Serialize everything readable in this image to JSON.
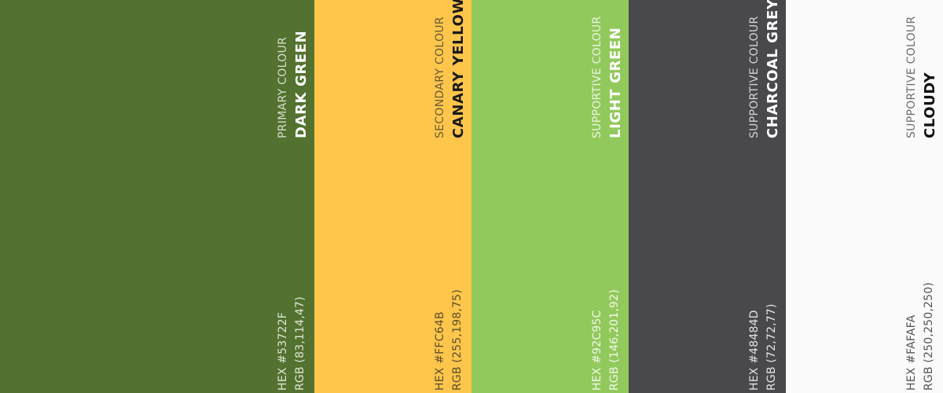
{
  "swatches": [
    {
      "role": "PRIMARY COLOUR",
      "name": "DARK GREEN",
      "hex": "HEX #53722F",
      "rgb": "RGB (83,114,47)",
      "background": "#53722F",
      "role_color": "#d6dccd",
      "name_color": "#ffffff",
      "code_color": "#dfe5d7"
    },
    {
      "role": "SECONDARY COLOUR",
      "name": "CANARY YELLOW",
      "hex": "HEX #FFC64B",
      "rgb": "RGB (255,198,75)",
      "background": "#FFC64B",
      "role_color": "#6b5a35",
      "name_color": "#1a1a1a",
      "code_color": "#5c4d2c"
    },
    {
      "role": "SUPPORTIVE COLOUR",
      "name": "LIGHT GREEN",
      "hex": "HEX #92C95C",
      "rgb": "RGB (146,201,92)",
      "background": "#92C95C",
      "role_color": "#eaf4df",
      "name_color": "#ffffff",
      "code_color": "#f2f8ea"
    },
    {
      "role": "SUPPORTIVE COLOUR",
      "name": "CHARCOAL GREY",
      "hex": "HEX #48484D",
      "rgb": "RGB (72,72,77)",
      "background": "#48484D",
      "role_color": "#d5d5d8",
      "name_color": "#ffffff",
      "code_color": "#e3e3e6"
    },
    {
      "role": "SUPPORTIVE COLOUR",
      "name": "CLOUDY",
      "hex": "HEX #FAFAFA",
      "rgb": "RGB (250,250,250)",
      "background": "#FAFAFA",
      "role_color": "#6e6e73",
      "name_color": "#111111",
      "code_color": "#555559"
    }
  ]
}
